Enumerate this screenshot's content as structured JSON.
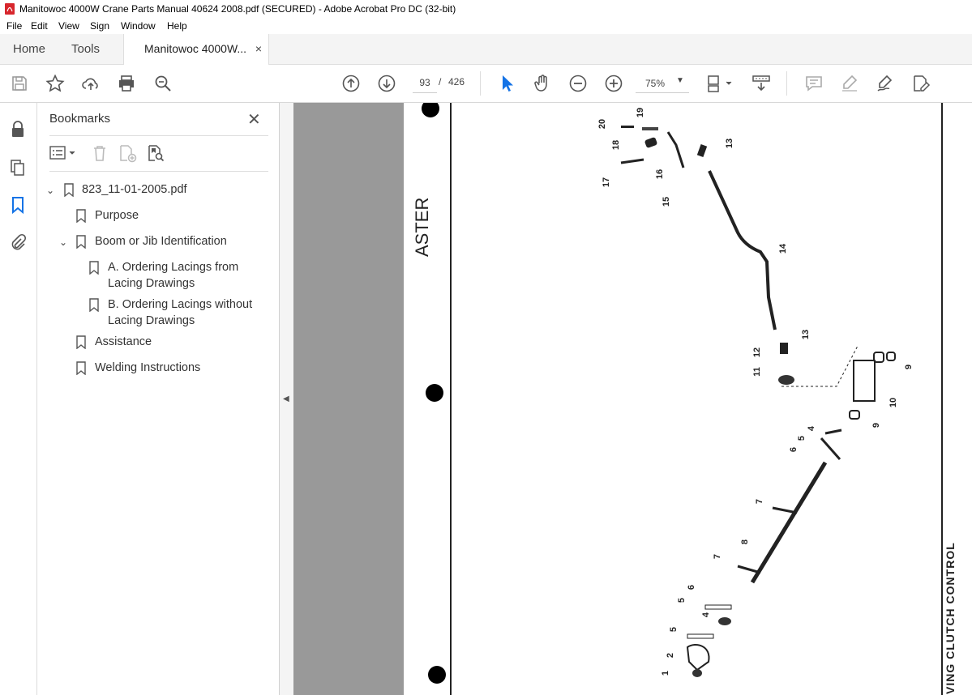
{
  "window": {
    "title": "Manitowoc 4000W Crane Parts Manual 40624 2008.pdf (SECURED) - Adobe Acrobat Pro DC (32-bit)"
  },
  "menu": [
    "File",
    "Edit",
    "View",
    "Sign",
    "Window",
    "Help"
  ],
  "tabs": {
    "home": "Home",
    "tools": "Tools",
    "document": "Manitowoc 4000W...",
    "close": "×"
  },
  "toolbar": {
    "page_current": "93",
    "page_sep": "/",
    "page_total": "426",
    "zoom": "75%"
  },
  "bookmarks": {
    "title": "Bookmarks",
    "items": [
      {
        "label": "823_11-01-2005.pdf",
        "level": 0,
        "expanded": true
      },
      {
        "label": "Purpose",
        "level": 1
      },
      {
        "label": "Boom or Jib Identification",
        "level": 1,
        "expanded": true
      },
      {
        "label": "A. Ordering Lacings from",
        "label2": "Lacing Drawings",
        "level": 2
      },
      {
        "label": "B. Ordering Lacings without",
        "label2": "Lacing Drawings",
        "level": 2
      },
      {
        "label": "Assistance",
        "level": 1
      },
      {
        "label": "Welding Instructions",
        "level": 1
      }
    ]
  },
  "document_page": {
    "side_text": "ASTER",
    "caption": "VING CLUTCH CONTROL",
    "callouts": [
      "20",
      "19",
      "18",
      "17",
      "16",
      "15",
      "13",
      "14",
      "13",
      "12",
      "11",
      "9",
      "10",
      "9",
      "4",
      "5",
      "6",
      "7",
      "8",
      "7",
      "6",
      "5",
      "4",
      "5",
      "2",
      "1"
    ]
  },
  "colors": {
    "accent": "#1473e6",
    "icon": "#555555",
    "gray_bg": "#999999"
  }
}
